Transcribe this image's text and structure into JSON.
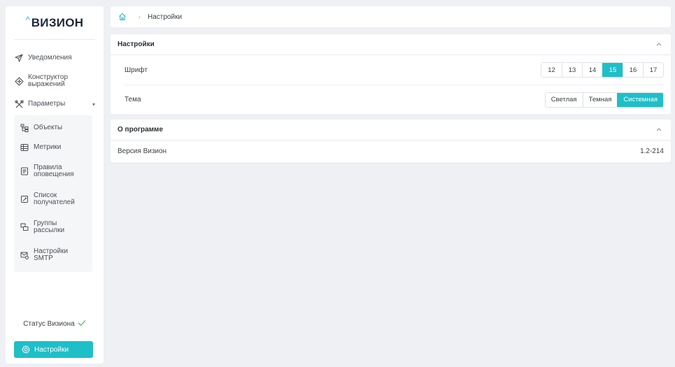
{
  "app": {
    "logo_text": "ВИЗИОН",
    "logo_caret": "^"
  },
  "colors": {
    "accent": "#1fbfc8",
    "status_ok": "#4cc46a"
  },
  "sidebar": {
    "items": [
      {
        "label": "Уведомления",
        "icon": "send-icon"
      },
      {
        "label": "Конструктор выражений",
        "icon": "expression-icon"
      },
      {
        "label": "Параметры",
        "icon": "tools-icon",
        "expanded": true
      }
    ],
    "sub_items": [
      {
        "label": "Объекты",
        "icon": "objects-icon"
      },
      {
        "label": "Метрики",
        "icon": "metrics-icon"
      },
      {
        "label": "Правила оповещения",
        "icon": "rules-icon"
      },
      {
        "label": "Список получателей",
        "icon": "recipients-icon"
      },
      {
        "label": "Группы рассылки",
        "icon": "groups-icon"
      },
      {
        "label": "Настройки SMTP",
        "icon": "smtp-icon"
      }
    ],
    "status_label": "Статус Визиона",
    "settings_label": "Настройки"
  },
  "breadcrumb": {
    "current": "Настройки"
  },
  "settings_card": {
    "title": "Настройки",
    "font_label": "Шрифт",
    "font_options": [
      "12",
      "13",
      "14",
      "15",
      "16",
      "17"
    ],
    "font_selected": "15",
    "theme_label": "Тема",
    "theme_options": [
      "Светлая",
      "Темная",
      "Системная"
    ],
    "theme_selected": "Системная"
  },
  "about_card": {
    "title": "О программе",
    "version_label": "Версия Визион",
    "version_value": "1.2-214"
  }
}
